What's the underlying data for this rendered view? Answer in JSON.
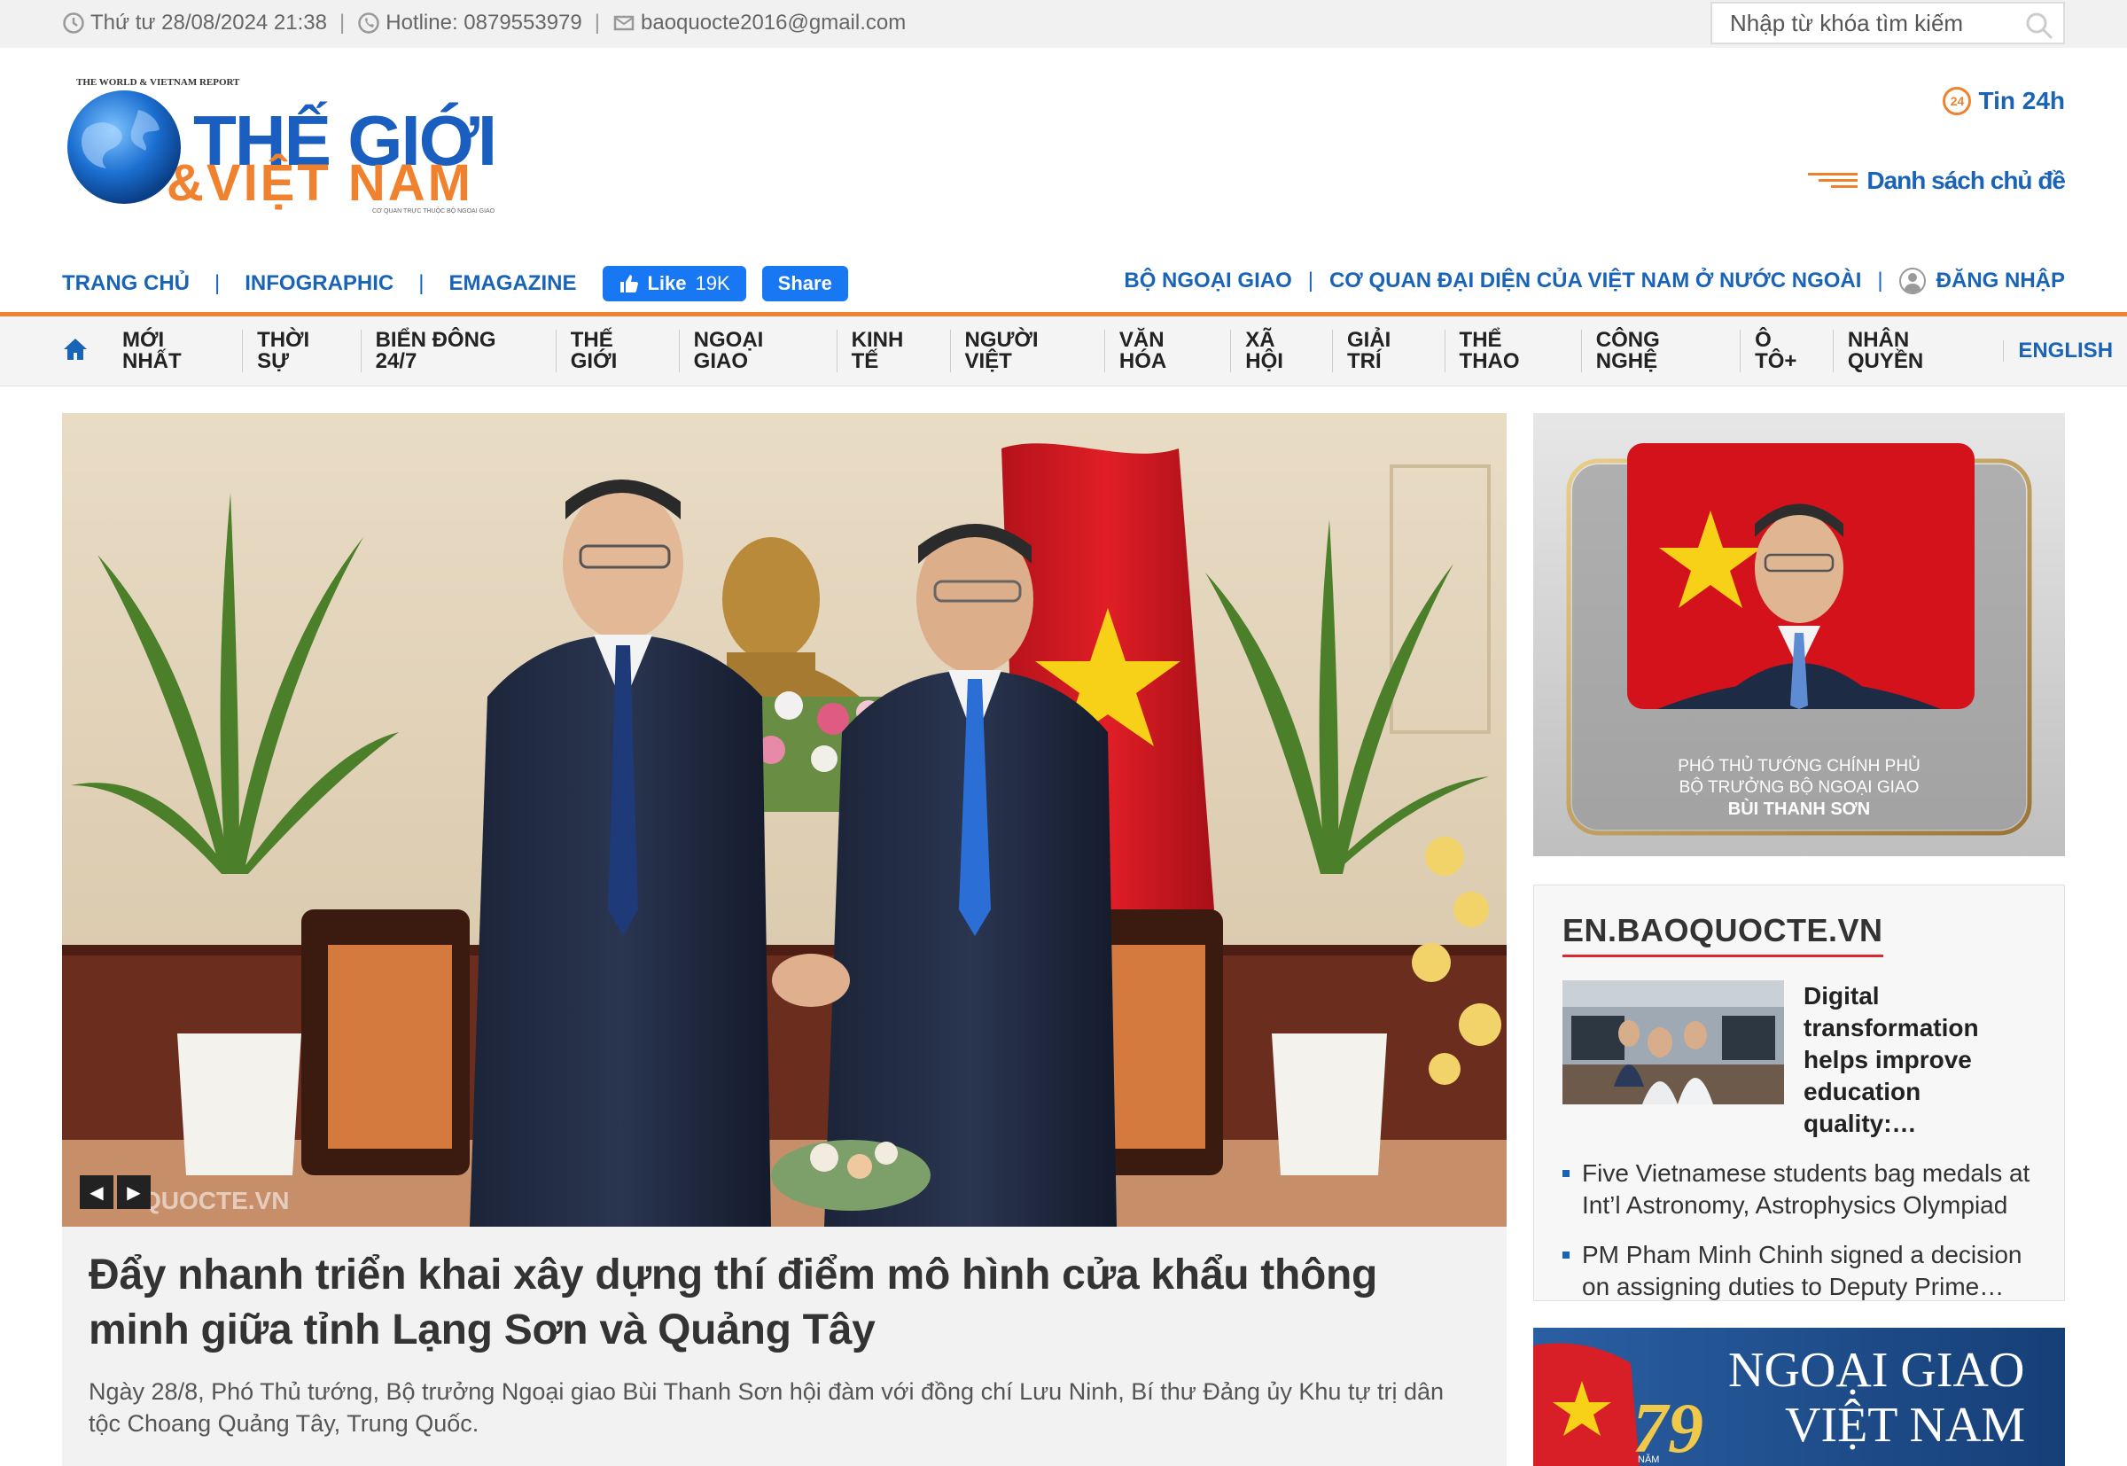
{
  "topbar": {
    "datetime": "Thứ tư 28/08/2024 21:38",
    "hotline": "Hotline: 0879553979",
    "email": "baoquocte2016@gmail.com",
    "search_placeholder": "Nhập từ khóa tìm kiếm"
  },
  "logo": {
    "tagline": "THE WORLD & VIETNAM REPORT",
    "line1": "THẾ GIỚI",
    "line2": "&VIỆT NAM",
    "sub": "CƠ QUAN TRỰC THUỘC BỘ NGOẠI GIAO"
  },
  "header": {
    "tin24": "Tin 24h",
    "tin24_badge": "24",
    "danh_sach": "Danh sách chủ đề"
  },
  "subnav": {
    "left": [
      "TRANG CHỦ",
      "INFOGRAPHIC",
      "EMAGAZINE"
    ],
    "fb_like": "Like",
    "fb_count": "19K",
    "fb_share": "Share",
    "right": [
      "BỘ NGOẠI GIAO",
      "CƠ QUAN ĐẠI DIỆN CỦA VIỆT NAM Ở NƯỚC NGOÀI"
    ],
    "login": "ĐĂNG NHẬP"
  },
  "mainnav": [
    "MỚI NHẤT",
    "THỜI SỰ",
    "BIỂN ĐÔNG 24/7",
    "THẾ GIỚI",
    "NGOẠI GIAO",
    "KINH TẾ",
    "NGƯỜI VIỆT",
    "VĂN HÓA",
    "XÃ HỘI",
    "GIẢI TRÍ",
    "THỂ THAO",
    "CÔNG NGHỆ",
    "Ô TÔ+",
    "NHÂN QUYỀN",
    "ENGLISH"
  ],
  "hero": {
    "watermark": "QUOCTE.VN",
    "title": "Đẩy nhanh triển khai xây dựng thí điểm mô hình cửa khẩu thông minh giữa tỉnh Lạng Sơn và Quảng Tây",
    "summary": "Ngày 28/8, Phó Thủ tướng, Bộ trưởng Ngoại giao Bùi Thanh Sơn hội đàm với đồng chí Lưu Ninh, Bí thư Đảng ủy Khu tự trị dân tộc Choang Quảng Tây, Trung Quốc."
  },
  "promo": {
    "line1": "PHÓ THỦ TƯỚNG CHÍNH PHỦ",
    "line2": "BỘ TRƯỞNG BỘ NGOẠI GIAO",
    "name": "BÙI THANH SƠN"
  },
  "en": {
    "heading": "EN.BAOQUOCTE.VN",
    "feature": "Digital transformation helps improve education quality:…",
    "items": [
      "Five Vietnamese students bag medals at Int’l Astronomy, Astrophysics Olympiad",
      "PM Pham Minh Chinh signed a decision on assigning duties to Deputy Prime…"
    ]
  },
  "banner": {
    "number": "79",
    "number_sub": "NĂM",
    "line1": "NGOẠI GIAO",
    "line2": "VIỆT NAM"
  },
  "colors": {
    "brand_blue": "#1a64b8",
    "accent_orange": "#f0812e",
    "facebook": "#1877f2",
    "heading_red": "#d9282f"
  }
}
